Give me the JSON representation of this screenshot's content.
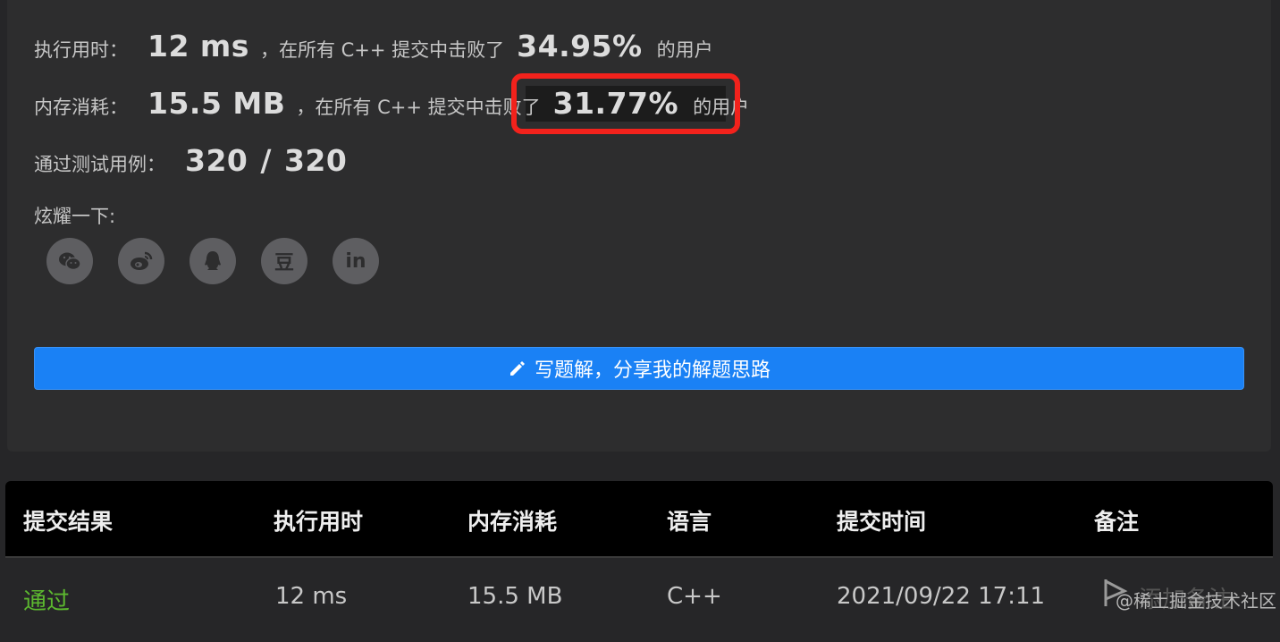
{
  "stats": {
    "runtime": {
      "label": "执行用时：",
      "value": "12 ms",
      "prefix": "，在所有 C++ 提交中击败了",
      "percent": "34.95%",
      "suffix": "的用户"
    },
    "memory": {
      "label": "内存消耗：",
      "value": "15.5 MB",
      "prefix": "，在所有 C++ 提交中击败了",
      "percent": "31.77%",
      "suffix": "的用户"
    },
    "tests": {
      "label": "通过测试用例：",
      "passed": "320",
      "sep": "/",
      "total": "320"
    }
  },
  "share": {
    "label": "炫耀一下:",
    "icons": [
      "wechat-icon",
      "weibo-icon",
      "qq-icon",
      "douban-icon",
      "linkedin-icon"
    ],
    "douban_glyph": "豆",
    "linkedin_glyph": "in"
  },
  "write_button": {
    "label": "写题解，分享我的解题思路",
    "color": "#1a81f5"
  },
  "table": {
    "columns": [
      "提交结果",
      "执行用时",
      "内存消耗",
      "语言",
      "提交时间",
      "备注"
    ],
    "rows": [
      {
        "result": "通过",
        "runtime": "12 ms",
        "memory": "15.5 MB",
        "language": "C++",
        "time": "2021/09/22 17:11",
        "note": "添加备注"
      }
    ]
  },
  "watermark": "@稀土掘金技术社区",
  "colors": {
    "pass": "#5cb82f",
    "highlight": "#f2221c"
  }
}
